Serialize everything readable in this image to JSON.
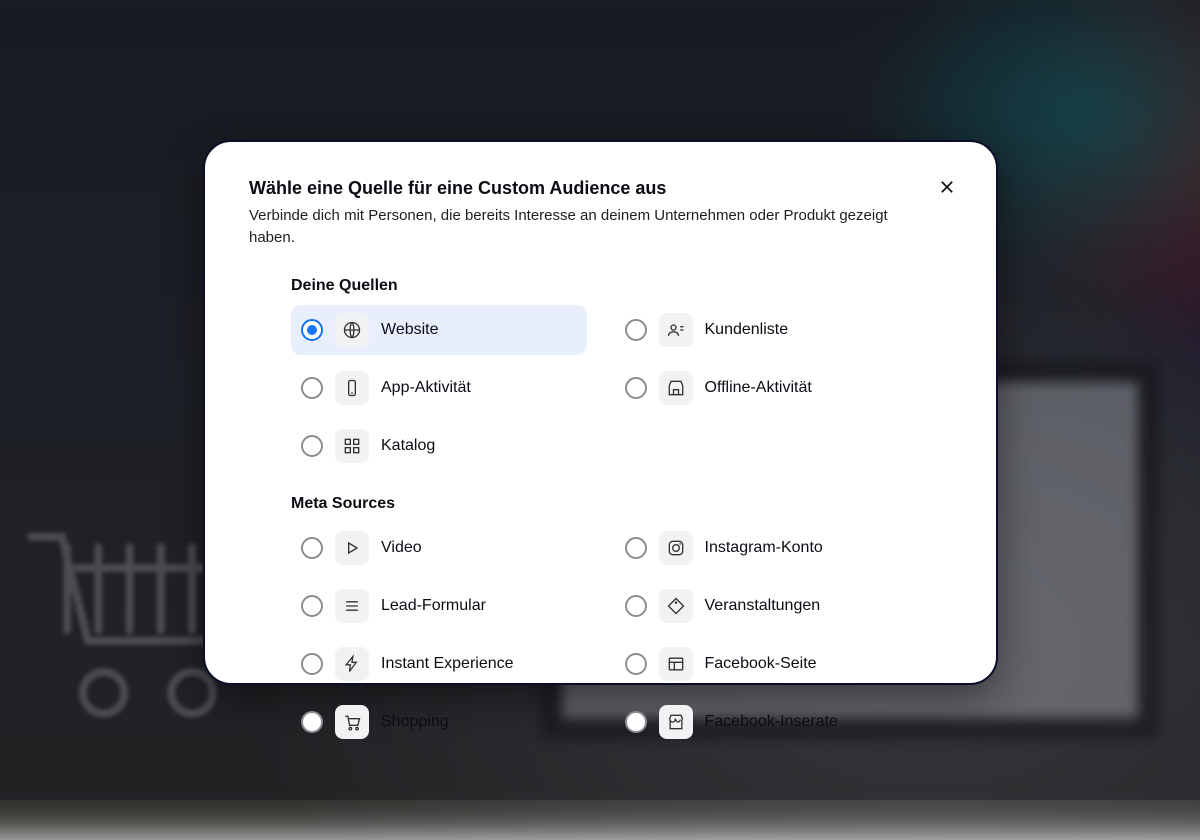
{
  "modal": {
    "title": "Wähle eine Quelle für eine Custom Audience aus",
    "subtitle": "Verbinde dich mit Personen, die bereits Interesse an deinem Unternehmen oder Produkt gezeigt haben.",
    "selected": "website"
  },
  "groups": [
    {
      "title": "Deine Quellen",
      "options": [
        {
          "id": "website",
          "label": "Website",
          "icon": "globe"
        },
        {
          "id": "kunden",
          "label": "Kundenliste",
          "icon": "user-list"
        },
        {
          "id": "app",
          "label": "App-Aktivität",
          "icon": "phone"
        },
        {
          "id": "offline",
          "label": "Offline-Aktivität",
          "icon": "store"
        },
        {
          "id": "katalog",
          "label": "Katalog",
          "icon": "grid"
        }
      ]
    },
    {
      "title": "Meta Sources",
      "options": [
        {
          "id": "video",
          "label": "Video",
          "icon": "play"
        },
        {
          "id": "insta",
          "label": "Instagram-Konto",
          "icon": "instagram"
        },
        {
          "id": "lead",
          "label": "Lead-Formular",
          "icon": "lines"
        },
        {
          "id": "events",
          "label": "Veranstaltungen",
          "icon": "tag"
        },
        {
          "id": "instx",
          "label": "Instant Experience",
          "icon": "bolt"
        },
        {
          "id": "fbpage",
          "label": "Facebook-Seite",
          "icon": "layout"
        },
        {
          "id": "shopping",
          "label": "Shopping",
          "icon": "cart"
        },
        {
          "id": "fbins",
          "label": "Facebook-Inserate",
          "icon": "storefront"
        }
      ]
    }
  ],
  "colors": {
    "accent": "#1877f2"
  }
}
